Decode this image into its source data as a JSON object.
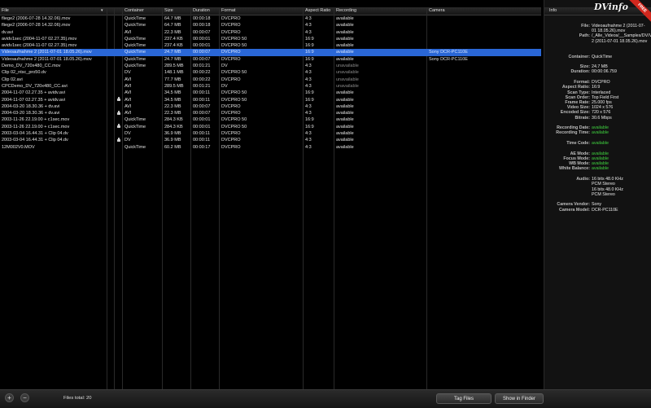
{
  "table": {
    "headers": {
      "file": "File",
      "container": "Container",
      "size": "Size",
      "duration": "Duration",
      "format": "Format",
      "aspect": "Aspect Ratio",
      "recording": "Recording",
      "camera": "Camera"
    },
    "rows": [
      {
        "file": "fliege2 (2006-07-28 14.32.06).mov",
        "container": "QuickTime",
        "size": "64.7 MB",
        "duration": "00:00:18",
        "format": "DVCPRO",
        "aspect": "4:3",
        "recording": "available",
        "camera": "",
        "lock": false,
        "selected": false
      },
      {
        "file": "fliege2 (2006-07-28 14.32.06).mov",
        "container": "QuickTime",
        "size": "64.7 MB",
        "duration": "00:00:18",
        "format": "DVCPRO",
        "aspect": "4:3",
        "recording": "available",
        "camera": "",
        "lock": false,
        "selected": false
      },
      {
        "file": "dv.avi",
        "container": "AVI",
        "size": "22.3 MB",
        "duration": "00:00:07",
        "format": "DVCPRO",
        "aspect": "4:3",
        "recording": "available",
        "camera": "",
        "lock": false,
        "selected": false
      },
      {
        "file": "avidv1sec (2004-11-07 02.27.35).mov",
        "container": "QuickTime",
        "size": "237.4 KB",
        "duration": "00:00:01",
        "format": "DVCPRO 50",
        "aspect": "16:9",
        "recording": "available",
        "camera": "",
        "lock": false,
        "selected": false
      },
      {
        "file": "avidv1sec (2004-11-07 02.27.35).mov",
        "container": "QuickTime",
        "size": "237.4 KB",
        "duration": "00:00:01",
        "format": "DVCPRO 50",
        "aspect": "16:9",
        "recording": "available",
        "camera": "",
        "lock": false,
        "selected": false
      },
      {
        "file": "Videoaufnahme 2 (2011-07-01 18.05.26).mov",
        "container": "QuickTime",
        "size": "24.7 MB",
        "duration": "00:00:07",
        "format": "DVCPRO",
        "aspect": "16:9",
        "recording": "available",
        "camera": "Sony DCR-PC110E",
        "lock": false,
        "selected": true
      },
      {
        "file": "Videoaufnahme 2 (2011-07-01 18.05.26).mov",
        "container": "QuickTime",
        "size": "24.7 MB",
        "duration": "00:00:07",
        "format": "DVCPRO",
        "aspect": "16:9",
        "recording": "available",
        "camera": "Sony DCR-PC110E",
        "lock": false,
        "selected": false
      },
      {
        "file": "Demo_DV_720x480_CC.mov",
        "container": "QuickTime",
        "size": "289.5 MB",
        "duration": "00:01:21",
        "format": "DV",
        "aspect": "4:3",
        "recording": "unavailable",
        "camera": "",
        "lock": false,
        "selected": false
      },
      {
        "file": "Clip 02_ntsc_pro50.dv",
        "container": "DV",
        "size": "148.1 MB",
        "duration": "00:00:22",
        "format": "DVCPRO 50",
        "aspect": "4:3",
        "recording": "unavailable",
        "camera": "",
        "lock": false,
        "selected": false
      },
      {
        "file": "Clip 02.avi",
        "container": "AVI",
        "size": "77.7 MB",
        "duration": "00:00:22",
        "format": "DVCPRO",
        "aspect": "4:3",
        "recording": "unavailable",
        "camera": "",
        "lock": false,
        "selected": false
      },
      {
        "file": "CPCDemo_DV_720x480_CC.avi",
        "container": "AVI",
        "size": "289.5 MB",
        "duration": "00:01:21",
        "format": "DV",
        "aspect": "4:3",
        "recording": "unavailable",
        "camera": "",
        "lock": false,
        "selected": false
      },
      {
        "file": "2004-11-07 02.27.35 + avidv.avi",
        "container": "AVI",
        "size": "34.5 MB",
        "duration": "00:00:11",
        "format": "DVCPRO 50",
        "aspect": "16:9",
        "recording": "available",
        "camera": "",
        "lock": false,
        "selected": false
      },
      {
        "file": "2004-11-07 02.27.35 + avidv.avi",
        "container": "AVI",
        "size": "34.5 MB",
        "duration": "00:00:11",
        "format": "DVCPRO 50",
        "aspect": "16:9",
        "recording": "available",
        "camera": "",
        "lock": true,
        "selected": false
      },
      {
        "file": "2004-03-20 18.30.36 + dv.avi",
        "container": "AVI",
        "size": "22.3 MB",
        "duration": "00:00:07",
        "format": "DVCPRO",
        "aspect": "4:3",
        "recording": "available",
        "camera": "",
        "lock": false,
        "selected": false
      },
      {
        "file": "2004-03-20 18.30.36 + dv.avi",
        "container": "AVI",
        "size": "22.3 MB",
        "duration": "00:00:07",
        "format": "DVCPRO",
        "aspect": "4:3",
        "recording": "available",
        "camera": "",
        "lock": true,
        "selected": false
      },
      {
        "file": "2003-11-26 22.19.00 + c1sec.mov",
        "container": "QuickTime",
        "size": "284.3 KB",
        "duration": "00:00:01",
        "format": "DVCPRO 50",
        "aspect": "16:9",
        "recording": "available",
        "camera": "",
        "lock": false,
        "selected": false
      },
      {
        "file": "2003-11-26 22.19.00 + c1sec.mov",
        "container": "QuickTime",
        "size": "284.3 KB",
        "duration": "00:00:01",
        "format": "DVCPRO 50",
        "aspect": "16:9",
        "recording": "available",
        "camera": "",
        "lock": true,
        "selected": false
      },
      {
        "file": "2003-03-04 16.44.31 + Clip 04.dv",
        "container": "DV",
        "size": "36.9 MB",
        "duration": "00:00:11",
        "format": "DVCPRO",
        "aspect": "4:3",
        "recording": "available",
        "camera": "",
        "lock": false,
        "selected": false
      },
      {
        "file": "2003-03-04 16.44.31 + Clip 04.dv",
        "container": "DV",
        "size": "36.9 MB",
        "duration": "00:00:11",
        "format": "DVCPRO",
        "aspect": "4:3",
        "recording": "available",
        "camera": "",
        "lock": true,
        "selected": false
      },
      {
        "file": "12M002V0.MOV",
        "container": "QuickTime",
        "size": "60.2 MB",
        "duration": "00:00:17",
        "format": "DVCPRO",
        "aspect": "4:3",
        "recording": "available",
        "camera": "",
        "lock": false,
        "selected": false
      }
    ]
  },
  "info": {
    "title": "Info",
    "rows": [
      {
        "label": "File:",
        "value": "Videoaufnahme 2 (2011-07-01 18.05.26).mov",
        "lines": 2
      },
      {
        "label": "Path:",
        "value": "/_Alle_Videos/__Samples/DV/Videoaufnahme 2 (2011-07-01 18.05.26).mov",
        "lines": 3
      },
      {
        "gap": 1
      },
      {
        "label": "Container:",
        "value": "QuickTime",
        "lines": 1
      },
      {
        "gap": 1
      },
      {
        "label": "Size:",
        "value": "24.7 MB",
        "lines": 1
      },
      {
        "label": "Duration:",
        "value": "00:00:06.759",
        "lines": 1
      },
      {
        "gap": 1
      },
      {
        "label": "Format:",
        "value": "DVCPRO",
        "lines": 1
      },
      {
        "label": "Aspect Ratio:",
        "value": "16:9",
        "lines": 1
      },
      {
        "label": "Scan Type:",
        "value": "Interlaced",
        "lines": 1
      },
      {
        "label": "Scan Order:",
        "value": "Top Field First",
        "lines": 1
      },
      {
        "label": "Frame Rate:",
        "value": "25.000 fps",
        "lines": 1
      },
      {
        "label": "Video Size:",
        "value": "1024 x 576",
        "lines": 1
      },
      {
        "label": "Encoded Size:",
        "value": "720 x 576",
        "lines": 1
      },
      {
        "label": "Bitrate:",
        "value": "30.6 Mbps",
        "lines": 1
      },
      {
        "gap": 1
      },
      {
        "label": "Recording Date:",
        "value": "available",
        "lines": 1,
        "green": true
      },
      {
        "label": "Recording Time:",
        "value": "available",
        "lines": 1,
        "green": true
      },
      {
        "gap": 1
      },
      {
        "label": "Time Code:",
        "value": "available",
        "lines": 1,
        "green": true
      },
      {
        "gap": 1
      },
      {
        "label": "AE Mode:",
        "value": "available",
        "lines": 1,
        "green": true
      },
      {
        "label": "Focus Mode:",
        "value": "available",
        "lines": 1,
        "green": true
      },
      {
        "label": "WB Mode:",
        "value": "available",
        "lines": 1,
        "green": true
      },
      {
        "label": "White Balance:",
        "value": "available",
        "lines": 1,
        "green": true
      },
      {
        "gap": 1
      },
      {
        "label": "Audio:",
        "value": "16 bits 48.0 KHz",
        "lines": 1
      },
      {
        "label": "",
        "value": "PCM Stereo",
        "lines": 1
      },
      {
        "label": "",
        "value": "16 bits 48.0 KHz",
        "lines": 1
      },
      {
        "label": "",
        "value": "PCM Stereo",
        "lines": 1
      },
      {
        "gap": 1
      },
      {
        "label": "Camera Vendor:",
        "value": "Sony",
        "lines": 1
      },
      {
        "label": "Camera Model:",
        "value": "DCR-PC110E",
        "lines": 1
      }
    ]
  },
  "logo": {
    "text": "DVinfo",
    "badge": "FREE"
  },
  "bottom": {
    "add_symbol": "+",
    "remove_symbol": "−",
    "files_total": "Files total: 20",
    "tag_files": "Tag Files",
    "show_in_finder": "Show in Finder"
  },
  "colors": {
    "selection": "#2a67d6",
    "available_green": "#3fd23f"
  }
}
